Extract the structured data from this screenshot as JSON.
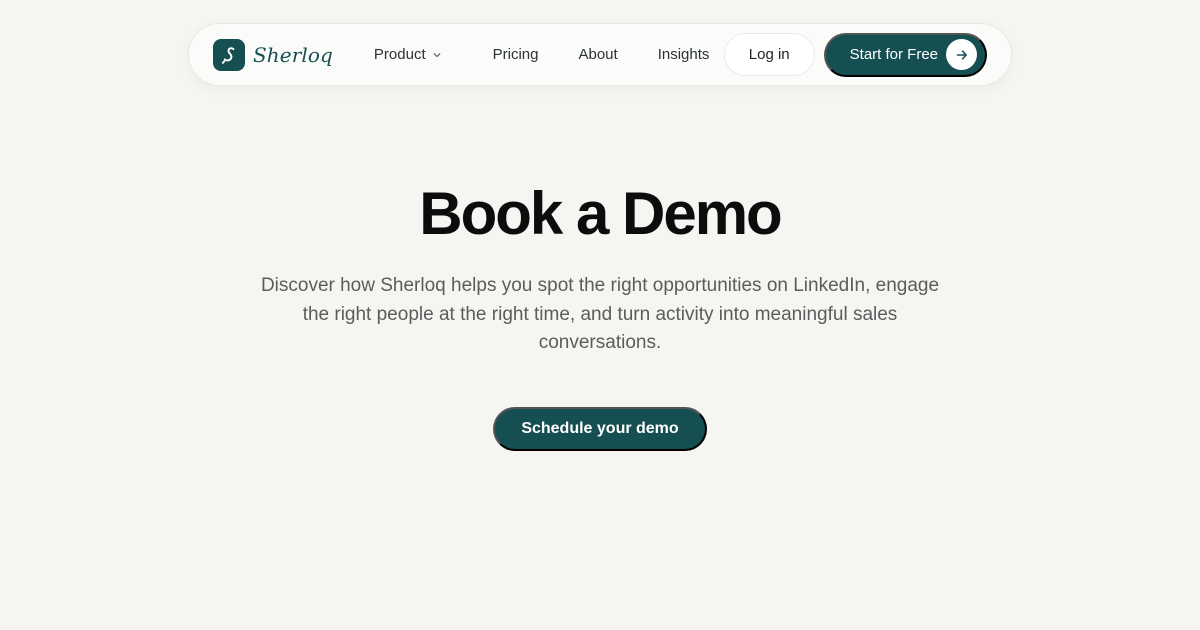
{
  "nav": {
    "brand": {
      "name": "Sherloq",
      "logo_icon": "sherloq-s-mark-icon"
    },
    "links": [
      {
        "label": "Product",
        "has_dropdown": true
      },
      {
        "label": "Pricing"
      },
      {
        "label": "About"
      },
      {
        "label": "Insights"
      }
    ],
    "login_label": "Log in",
    "start_label": "Start for Free",
    "start_icon": "arrow-right-icon"
  },
  "hero": {
    "title": "Book a Demo",
    "subtitle": "Discover how Sherloq helps you spot the right opportunities on LinkedIn, engage the right people at the right time, and turn activity into meaningful sales conversations.",
    "cta_label": "Schedule your demo"
  },
  "colors": {
    "background": "#f6f5f2",
    "brand": "#154f52",
    "title": "#0b0d0d",
    "body_text": "#5a5d5c"
  }
}
